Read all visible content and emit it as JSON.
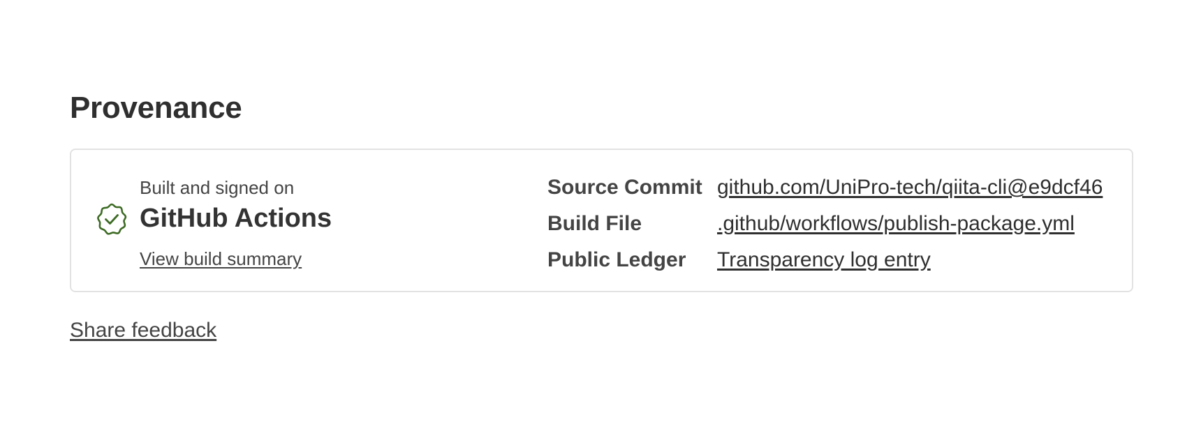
{
  "section": {
    "title": "Provenance"
  },
  "build": {
    "built_on_label": "Built and signed on",
    "platform": "GitHub Actions",
    "summary_link": "View build summary",
    "badge_icon": "verified-check-icon",
    "badge_color": "#3d6b24"
  },
  "details": [
    {
      "label": "Source Commit",
      "value": "github.com/UniPro-tech/qiita-cli@e9dcf46"
    },
    {
      "label": "Build File",
      "value": ".github/workflows/publish-package.yml"
    },
    {
      "label": "Public Ledger",
      "value": "Transparency log entry"
    }
  ],
  "feedback": {
    "label": "Share feedback"
  }
}
